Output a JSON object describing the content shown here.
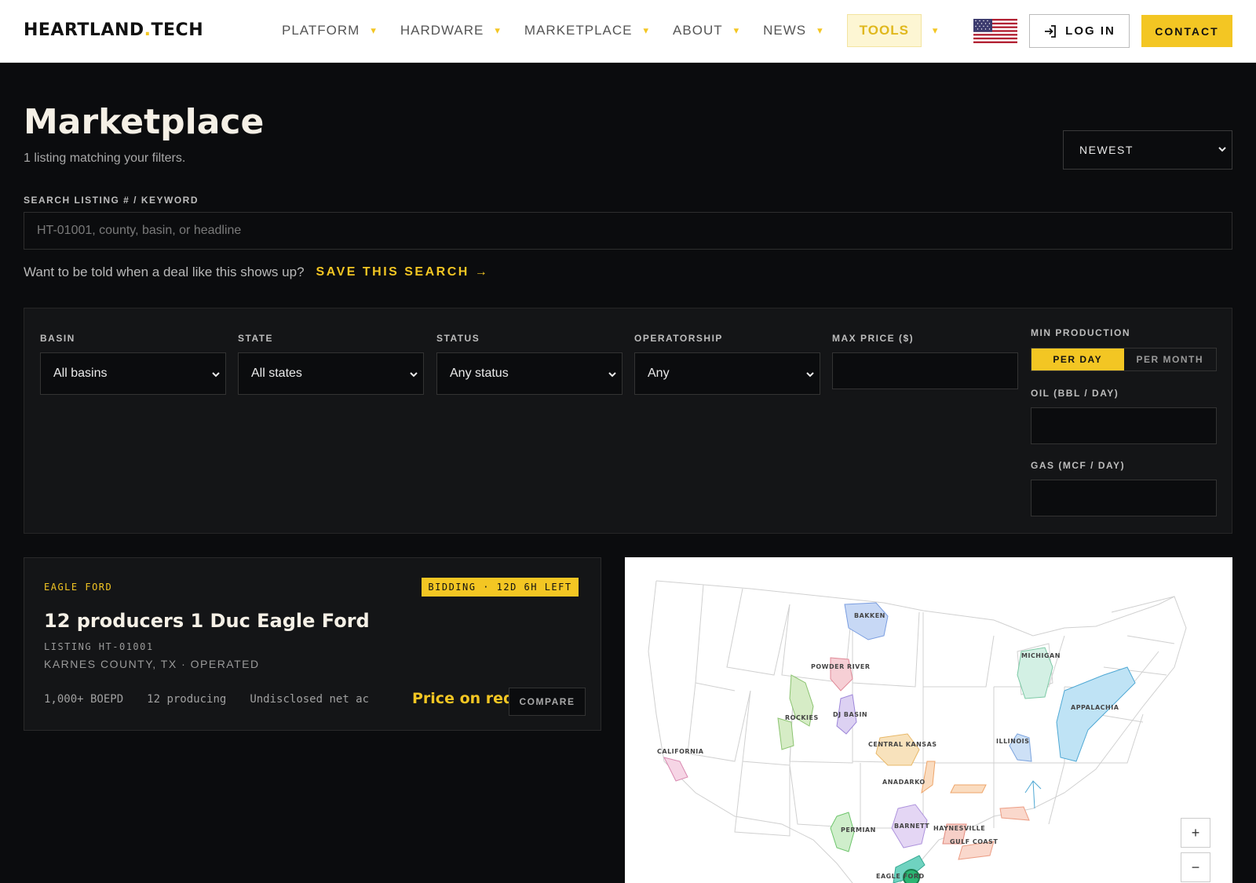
{
  "header": {
    "logo_main": "HEARTLAND",
    "logo_dot": ".",
    "logo_suffix": "TECH",
    "nav": [
      {
        "label": "PLATFORM",
        "caret": "▾"
      },
      {
        "label": "HARDWARE",
        "caret": "▾"
      },
      {
        "label": "MARKETPLACE",
        "caret": "▾"
      },
      {
        "label": "ABOUT",
        "caret": "▾"
      },
      {
        "label": "NEWS",
        "caret": "▾"
      },
      {
        "label": "TOOLS",
        "caret": "▾"
      }
    ],
    "login_label": "LOG IN",
    "contact_label": "CONTACT",
    "flag_icon": "us-flag-icon"
  },
  "page": {
    "title": "Marketplace",
    "result_count": "1 listing matching your filters.",
    "sort_value": "NEWEST"
  },
  "search": {
    "label": "SEARCH LISTING # / KEYWORD",
    "placeholder": "HT-01001, county, basin, or headline",
    "value": ""
  },
  "save_search": {
    "prompt": "Want to be told when a deal like this shows up?",
    "link": "SAVE THIS SEARCH →"
  },
  "filters": {
    "basin": {
      "label": "BASIN",
      "value": "All basins"
    },
    "state": {
      "label": "STATE",
      "value": "All states"
    },
    "status": {
      "label": "STATUS",
      "value": "Any status"
    },
    "operatorship": {
      "label": "OPERATORSHIP",
      "value": "Any"
    },
    "max_price": {
      "label": "MAX PRICE ($)",
      "value": ""
    },
    "min_production": {
      "label": "MIN PRODUCTION",
      "toggle_on": "PER DAY",
      "toggle_off": "PER MONTH",
      "oil_label": "OIL (BBL / DAY)",
      "oil_value": "",
      "gas_label": "GAS (MCF / DAY)",
      "gas_value": ""
    }
  },
  "listing": {
    "basin": "EAGLE FORD",
    "badge": "BIDDING · 12D 6H LEFT",
    "title": "12 producers 1 Duc Eagle Ford",
    "id": "LISTING HT-01001",
    "location": "KARNES COUNTY, TX · OPERATED",
    "stats": [
      "1,000+ BOEPD",
      "12 producing",
      "Undisclosed net ac"
    ],
    "price": "Price on request",
    "compare_label": "COMPARE"
  },
  "map": {
    "zoom_in": "+",
    "zoom_out": "−",
    "basins": [
      "BAKKEN",
      "POWDER RIVER",
      "MICHIGAN",
      "APPALACHIA",
      "ROCKIES",
      "DJ BASIN",
      "ILLINOIS",
      "CALIFORNIA",
      "CENTRAL KANSAS",
      "ANADARKO",
      "BARNETT",
      "HAYNESVILLE",
      "GULF COAST",
      "PERMIAN",
      "EAGLE FORD"
    ]
  },
  "colors": {
    "accent": "#f3c623",
    "background": "#0b0c0e",
    "panel": "#141517"
  }
}
